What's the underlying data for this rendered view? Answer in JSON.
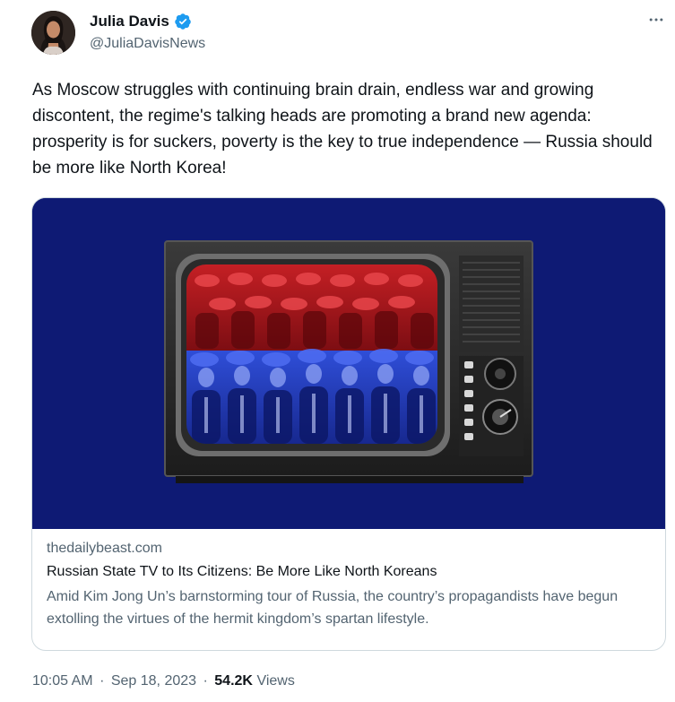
{
  "author": {
    "name": "Julia Davis",
    "handle": "@JuliaDavisNews",
    "verified": true
  },
  "tweet": {
    "text": "As Moscow struggles with continuing brain drain, endless war and growing discontent, the regime's talking heads are promoting a brand new agenda: prosperity is for suckers, poverty is the key to true independence — Russia should be more like North Korea!"
  },
  "card": {
    "domain": "thedailybeast.com",
    "title": "Russian State TV to Its Citizens: Be More Like North Koreans",
    "description": "Amid Kim Jong Un’s barnstorming tour of Russia, the country’s propagandists have begun extolling the virtues of the hermit kingdom’s spartan lifestyle."
  },
  "meta": {
    "time": "10:05 AM",
    "separator": "·",
    "date": "Sep 18, 2023",
    "views_count": "54.2K",
    "views_label": "Views"
  },
  "colors": {
    "verified_badge": "#1d9bf0",
    "image_background": "#0e1a74",
    "secondary_text": "#536471"
  },
  "icons": {
    "verified": "verified-badge-icon",
    "more": "more-horizontal-icon"
  }
}
